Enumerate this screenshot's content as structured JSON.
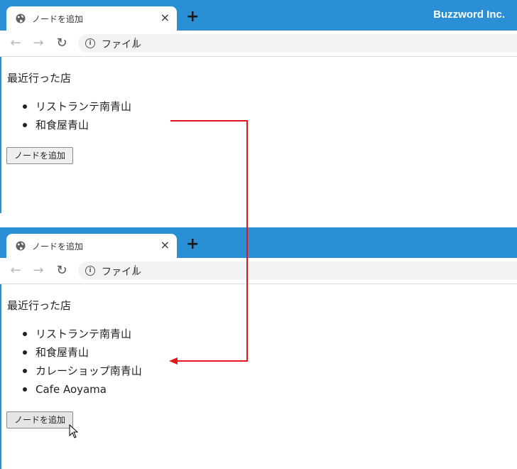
{
  "browser": {
    "tab_title": "ノードを追加",
    "tab_close": "×",
    "new_tab": "+",
    "brand": "Buzzword Inc.",
    "address_text": "ファイル",
    "address_sep": "|",
    "back": "←",
    "forward": "→",
    "reload": "↻",
    "info": "i"
  },
  "before": {
    "heading": "最近行った店",
    "items": [
      "リストランテ南青山",
      "和食屋青山"
    ],
    "button_label": "ノードを追加"
  },
  "after": {
    "heading": "最近行った店",
    "items": [
      "リストランテ南青山",
      "和食屋青山",
      "カレーショップ南青山",
      "Cafe Aoyama"
    ],
    "button_label": "ノードを追加"
  },
  "colors": {
    "tabbar": "#2b8fd6",
    "arrow": "#e0161b"
  },
  "icons": [
    "globe-icon",
    "close-icon",
    "plus-icon",
    "back-icon",
    "forward-icon",
    "reload-icon",
    "info-icon",
    "mouse-cursor-icon"
  ]
}
